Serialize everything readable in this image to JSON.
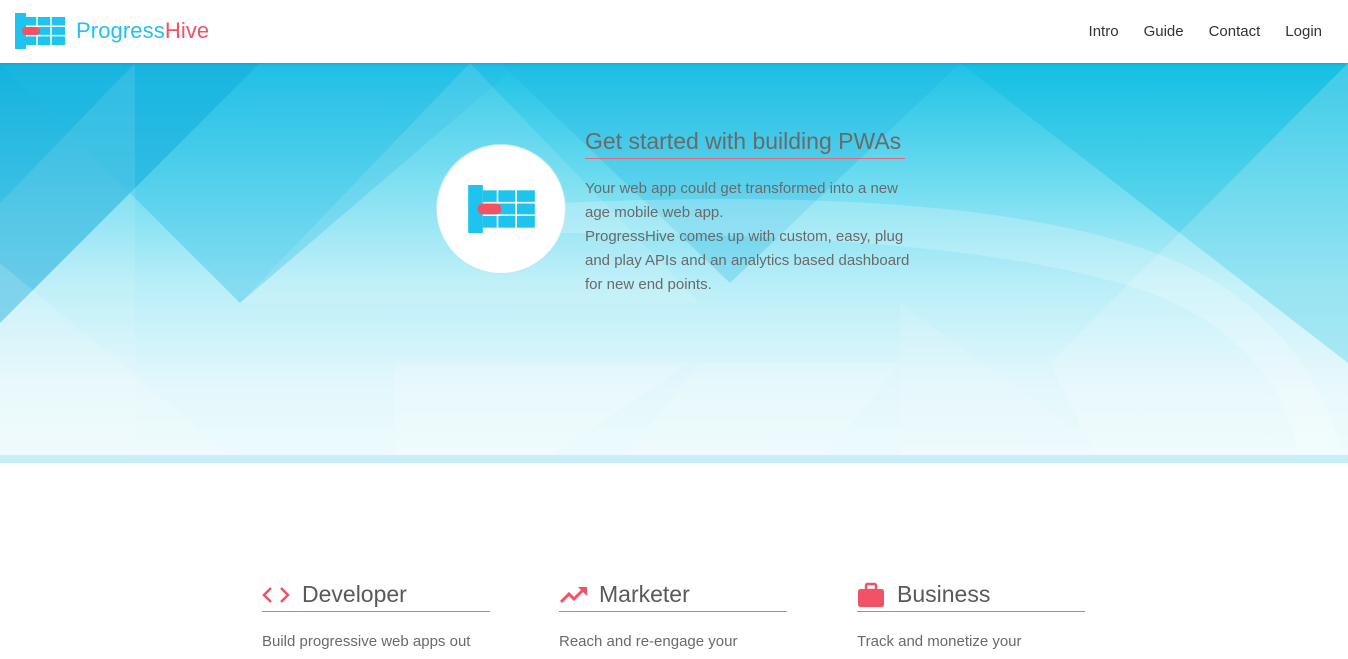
{
  "header": {
    "brand_main": "Progress",
    "brand_accent": "Hive",
    "nav": [
      {
        "label": "Intro"
      },
      {
        "label": "Guide"
      },
      {
        "label": "Contact"
      },
      {
        "label": "Login"
      }
    ]
  },
  "hero": {
    "title": "Get started with building PWAs",
    "description_line1": "Your web app could get transformed into a new age mobile web app.",
    "description_line2": "ProgressHive comes up with custom, easy, plug and play APIs and an analytics based dashboard for new end points."
  },
  "features": [
    {
      "icon": "code-icon",
      "title": "Developer",
      "text": "Build progressive web apps out"
    },
    {
      "icon": "trending-up-icon",
      "title": "Marketer",
      "text": "Reach and re-engage your"
    },
    {
      "icon": "briefcase-icon",
      "title": "Business",
      "text": "Track and monetize your"
    }
  ],
  "colors": {
    "brand_blue": "#1ec3ee",
    "brand_red": "#f25266",
    "accent_line": "#ee6b7c"
  }
}
